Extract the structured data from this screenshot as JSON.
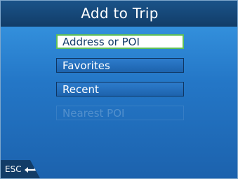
{
  "titlebar": {
    "title": "Add to Trip"
  },
  "menu": {
    "items": [
      {
        "label": "Address or POI",
        "state": "selected"
      },
      {
        "label": "Favorites",
        "state": "normal"
      },
      {
        "label": "Recent",
        "state": "normal"
      },
      {
        "label": "Nearest POI",
        "state": "disabled"
      }
    ]
  },
  "footer": {
    "esc_label": "ESC",
    "esc_icon": "return-arrow-icon"
  },
  "colors": {
    "accent": "#5fbf58",
    "title_bar": "#123d69",
    "background": "#2477c7"
  }
}
